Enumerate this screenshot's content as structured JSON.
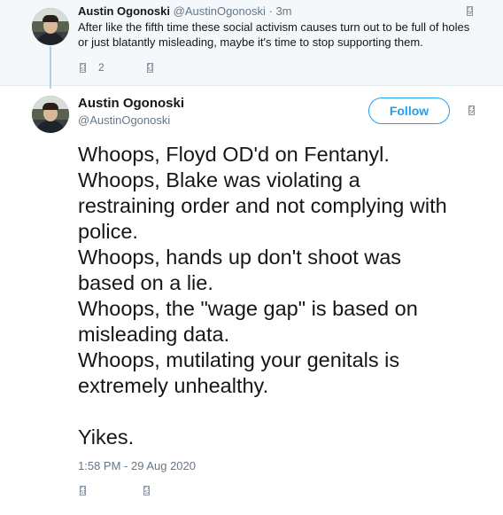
{
  "parent_tweet": {
    "author_name": "Austin Ogonoski",
    "handle": "@AustinOgonoski",
    "time": "· 3m",
    "text": "After like the fifth time these social activism causes turn out to be full of holes or just blatantly misleading, maybe it's time to stop supporting them.",
    "reply_count": "2",
    "icons": [
      "reply-icon",
      "retweet-icon",
      "more-options-icon"
    ]
  },
  "main_tweet": {
    "author_name": "Austin Ogonoski",
    "handle": "@AustinOgonoski",
    "follow_label": "Follow",
    "lines": [
      "Whoops, Floyd OD'd on Fentanyl.",
      "Whoops, Blake was violating a",
      "restraining order and not complying with",
      "police.",
      "Whoops, hands up don't shoot was",
      "based on a lie.",
      "Whoops, the \"wage gap\" is based on",
      "misleading data.",
      "Whoops, mutilating your genitals is",
      "extremely unhealthy.",
      "",
      "Yikes."
    ],
    "timestamp": "1:58 PM - 29 Aug 2020",
    "icons": [
      "reply-icon",
      "retweet-icon",
      "more-options-icon"
    ]
  },
  "colors": {
    "accent": "#1da1f2",
    "thread_line": "#a9d2ea",
    "muted_text": "#657786",
    "parent_background": "#f5f8fa"
  }
}
